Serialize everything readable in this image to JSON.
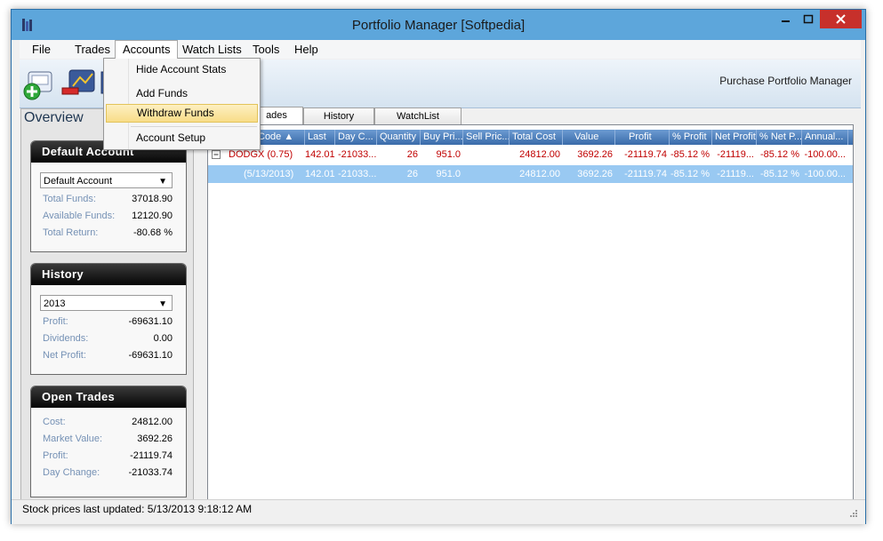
{
  "window": {
    "title": "Portfolio Manager [Softpedia]"
  },
  "menu": {
    "items": [
      "File",
      "Trades",
      "Accounts",
      "Watch Lists",
      "Tools",
      "Help"
    ]
  },
  "accounts_menu": {
    "items": [
      "Hide Account Stats",
      "Add Funds",
      "Withdraw Funds",
      "Account Setup"
    ],
    "highlighted": "Withdraw Funds"
  },
  "toolbar": {
    "brand": "Purchase Portfolio Manager"
  },
  "overview": {
    "title": "Overview",
    "default_account": {
      "title": "Default Account",
      "selected": "Default Account",
      "rows": [
        {
          "label": "Total Funds:",
          "value": "37018.90"
        },
        {
          "label": "Available Funds:",
          "value": "12120.90"
        },
        {
          "label": "Total Return:",
          "value": "-80.68 %"
        }
      ]
    },
    "history": {
      "title": "History",
      "selected": "2013",
      "rows": [
        {
          "label": "Profit:",
          "value": "-69631.10"
        },
        {
          "label": "Dividends:",
          "value": "0.00"
        },
        {
          "label": "Net Profit:",
          "value": "-69631.10"
        }
      ]
    },
    "open_trades": {
      "title": "Open Trades",
      "rows": [
        {
          "label": "Cost:",
          "value": "24812.00"
        },
        {
          "label": "Market Value:",
          "value": "3692.26"
        },
        {
          "label": "Profit:",
          "value": "-21119.74"
        },
        {
          "label": "Day Change:",
          "value": "-21033.74"
        }
      ]
    }
  },
  "tabs": [
    "ades",
    "History",
    "WatchList"
  ],
  "grid": {
    "columns": [
      "Code",
      "Last",
      "Day C...",
      "Quantity",
      "Buy Pri...",
      "Sell Pric...",
      "Total Cost",
      "Value",
      "Profit",
      "% Profit",
      "Net Profit",
      "% Net P...",
      "Annual..."
    ],
    "rows": [
      {
        "code": "DODGX (0.75)",
        "last": "142.01",
        "day_change": "-21033...",
        "quantity": "26",
        "buy_price": "951.0",
        "sell_price": "",
        "total_cost": "24812.00",
        "value": "3692.26",
        "profit": "-21119.74",
        "pct_profit": "-85.12 %",
        "net_profit": "-21119...",
        "pct_net_profit": "-85.12 %",
        "annual": "-100.00..."
      },
      {
        "code": "(5/13/2013)",
        "last": "142.01",
        "day_change": "-21033...",
        "quantity": "26",
        "buy_price": "951.0",
        "sell_price": "",
        "total_cost": "24812.00",
        "value": "3692.26",
        "profit": "-21119.74",
        "pct_profit": "-85.12 %",
        "net_profit": "-21119...",
        "pct_net_profit": "-85.12 %",
        "annual": "-100.00..."
      }
    ]
  },
  "status": {
    "text": "Stock prices last updated: 5/13/2013 9:18:12 AM"
  },
  "colors": {
    "titlebar": "#5da6db",
    "negative": "#c00000",
    "selected_row": "#99c9f2",
    "header": "#4a7ab9",
    "close": "#c7302b"
  }
}
